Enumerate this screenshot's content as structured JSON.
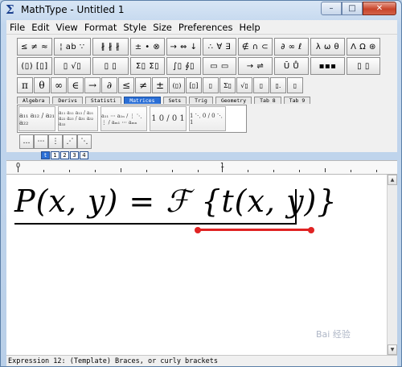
{
  "window": {
    "title": "MathType - Untitled 1",
    "app_icon": "Σ"
  },
  "caption_buttons": {
    "minimize": "–",
    "maximize": "□",
    "close": "✕"
  },
  "menu": [
    "File",
    "Edit",
    "View",
    "Format",
    "Style",
    "Size",
    "Preferences",
    "Help"
  ],
  "toolbar_row1": [
    "≤ ≠ ≈",
    "¦ ab ∵",
    "∦ ∦ ∦",
    "± • ⊗",
    "→ ⇔ ↓",
    "∴ ∀ ∃",
    "∉ ∩ ⊂",
    "∂ ∞ ℓ",
    "λ ω θ",
    "Λ Ω ⊛"
  ],
  "toolbar_row2": [
    "(▯) [▯]",
    "▯ √▯",
    "▯ ▯",
    "Σ▯ Σ▯",
    "∫▯ ∮▯",
    "▭ ▭",
    "→ ⇌",
    "Ū Ů",
    "▪▪▪",
    "▯ ▯"
  ],
  "toolbar_row3": [
    "π",
    "θ",
    "∞",
    "∈",
    "→",
    "∂",
    "≤",
    "≠",
    "±",
    "(▯)",
    "[▯]",
    "▯",
    "Σ▯",
    "√▯",
    "▯",
    "▯.",
    "▯"
  ],
  "tabs": [
    "Algebra",
    "Derivs",
    "Statisti",
    "Matrices",
    "Sets",
    "Trig",
    "Geometry",
    "Tab 8",
    "Tab 9"
  ],
  "active_tab": "Matrices",
  "templates": [
    "a₁₁ a₁₂ / a₂₁ a₂₂",
    "a₁₁ a₁₂ a₁₃ / a₂₁ a₂₂ a₂₃ / a₃₁ a₃₂ a₃₃",
    "a₁₁ ⋯ a₁ₙ / ⋮ ⋱ ⋮ / aₘ₁ ⋯ aₘₙ",
    "1 0 / 0 1",
    "1 ⋱ 0 / 0 ⋱ 1"
  ],
  "small_buttons": [
    "…",
    "⋯",
    "⋮",
    "⋰",
    "⋱"
  ],
  "size_buttons": [
    "t",
    "1",
    "2",
    "3",
    "4"
  ],
  "active_size": "t",
  "ruler": {
    "marks": [
      "0",
      "1"
    ]
  },
  "equation": {
    "text": "P(x, y) = ℱ {t(x, y)}"
  },
  "status": {
    "text": "Expression 12:  (Template) Braces, or curly brackets"
  },
  "watermark": {
    "text": "Bai 经验"
  },
  "annotation_color": "#e02323",
  "accent_color": "#2b6fd6"
}
